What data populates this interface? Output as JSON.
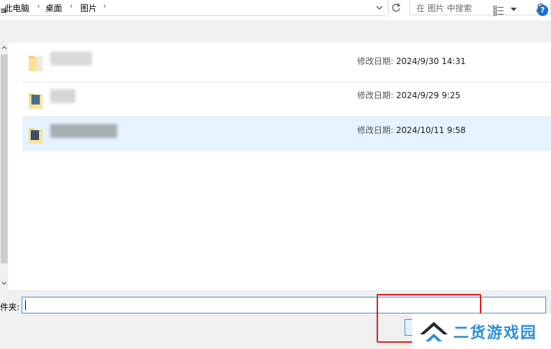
{
  "breadcrumb": [
    "此电脑",
    "桌面",
    "图片"
  ],
  "search": {
    "placeholder": "在 图片 中搜索"
  },
  "toolbar": {
    "left_label": "≡"
  },
  "files": [
    {
      "modified_label": "修改日期:",
      "modified_value": "2024/9/30 14:31",
      "selected": false
    },
    {
      "modified_label": "修改日期:",
      "modified_value": "2024/9/29 9:25",
      "selected": false
    },
    {
      "modified_label": "修改日期:",
      "modified_value": "2024/10/11 9:58",
      "selected": true
    }
  ],
  "bottom": {
    "folder_label": "件夹:",
    "folder_value": ""
  },
  "watermark": {
    "text": "二货游戏园"
  },
  "colors": {
    "accent": "#1e6fd0",
    "selection": "#e5f3ff",
    "highlight_box": "#e21b1b",
    "watermark": "#2d8fd8"
  }
}
